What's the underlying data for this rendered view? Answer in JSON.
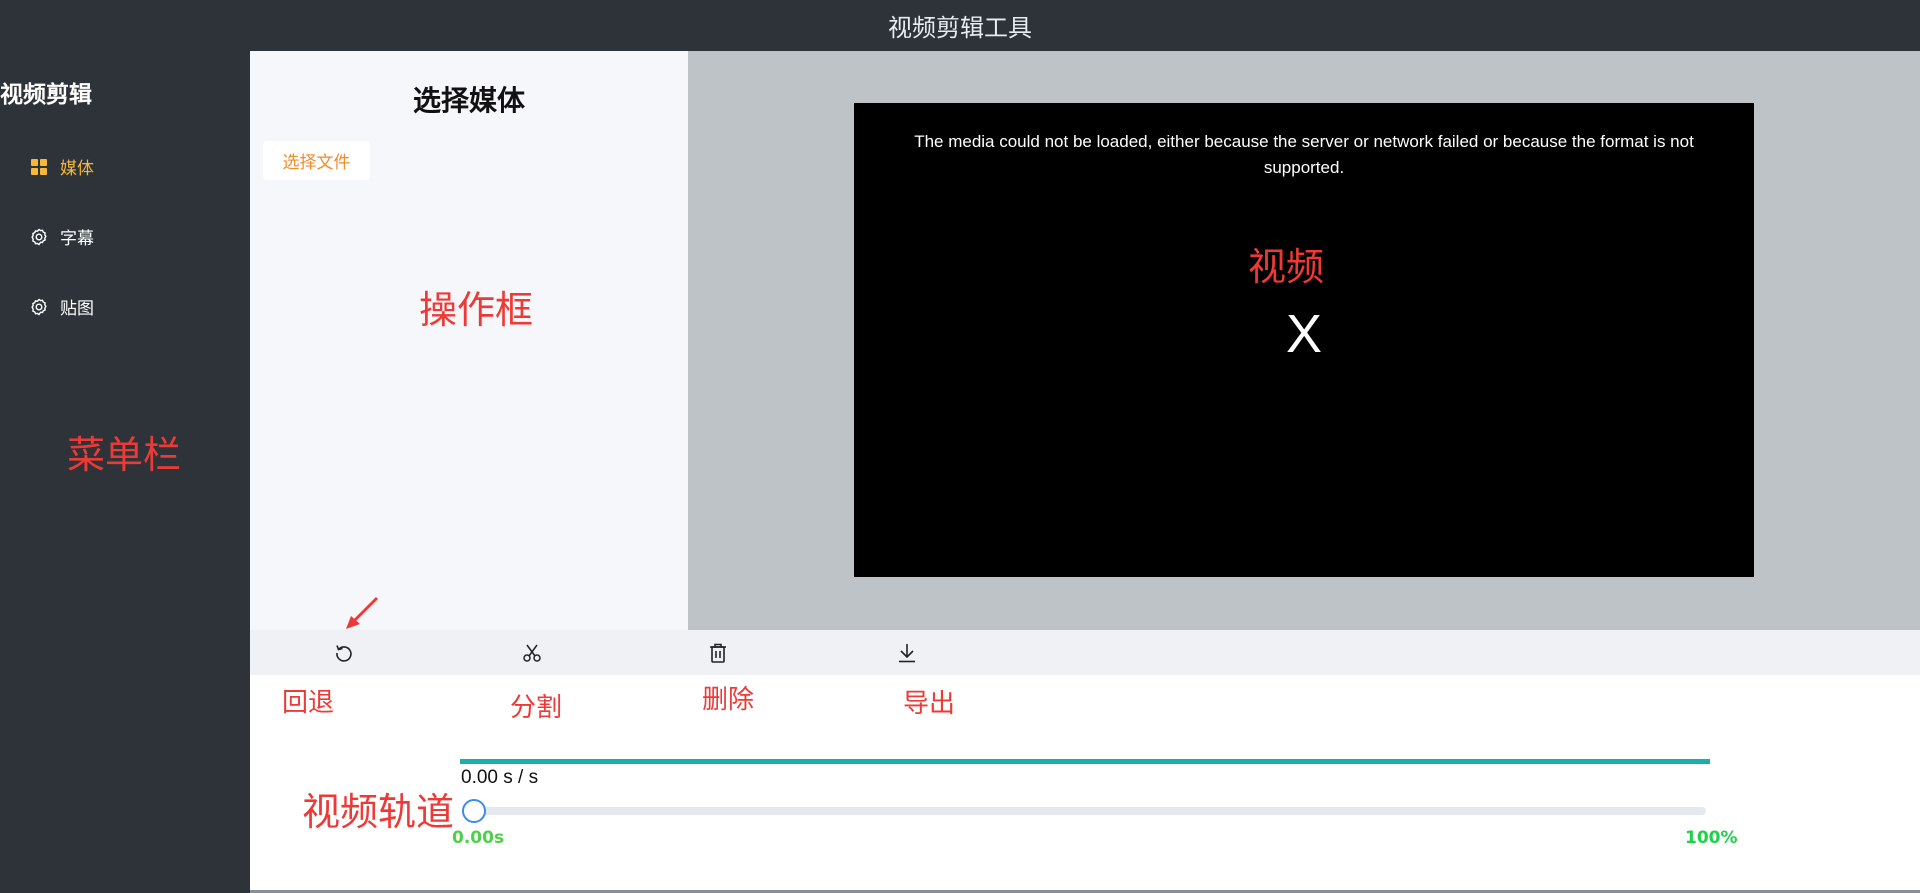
{
  "app": {
    "window_title": "视频剪辑工具"
  },
  "sidebar": {
    "brand": "视频剪辑",
    "items": [
      {
        "label": "媒体",
        "icon": "grid-icon",
        "active": true
      },
      {
        "label": "字幕",
        "icon": "gear-icon",
        "active": false
      },
      {
        "label": "贴图",
        "icon": "gear-icon",
        "active": false
      }
    ]
  },
  "panel": {
    "title": "选择媒体",
    "file_button": "选择文件"
  },
  "preview": {
    "error_message": "The media could not be loaded, either because the server or network failed or because the format is not supported.",
    "close_glyph": "X"
  },
  "toolbar": {
    "tools": [
      {
        "name": "undo",
        "icon": "undo-icon"
      },
      {
        "name": "split",
        "icon": "scissors-icon"
      },
      {
        "name": "delete",
        "icon": "trash-icon"
      },
      {
        "name": "export",
        "icon": "download-icon"
      }
    ]
  },
  "timeline": {
    "time_text": "0.00 s / s",
    "start_label": "0.00s",
    "end_label": "100%",
    "progress_fraction": 0
  },
  "annotations": {
    "menu": "菜单栏",
    "panel": "操作框",
    "video": "视频",
    "undo": "回退",
    "split": "分割",
    "delete": "删除",
    "export": "导出",
    "track": "视频轨道"
  },
  "colors": {
    "accent": "#f7b737",
    "annotation": "#ee3a36",
    "track": "#19aeb0",
    "slider": "#3b8bea"
  }
}
